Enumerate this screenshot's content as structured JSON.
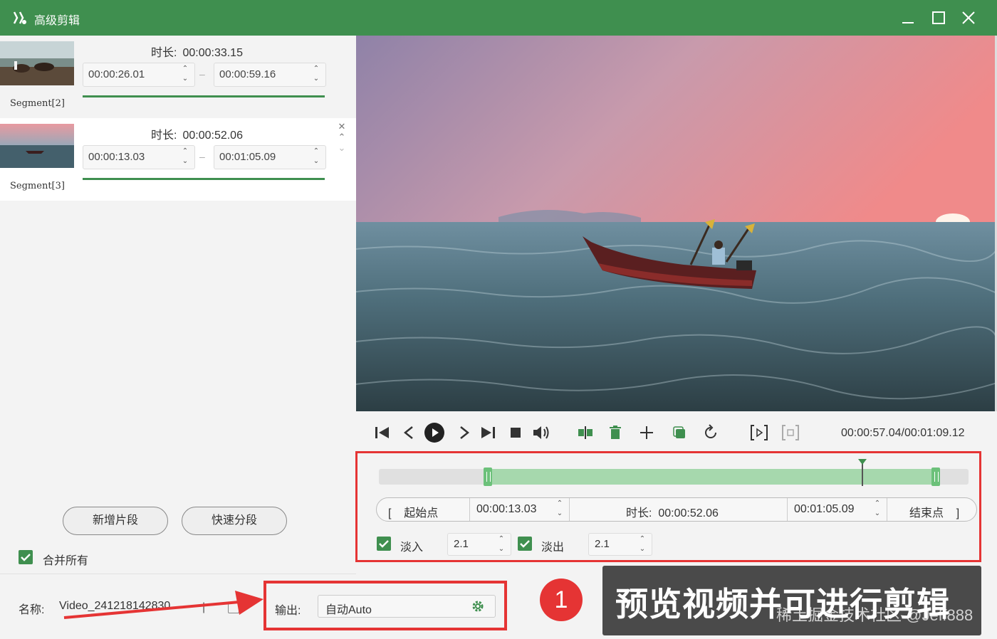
{
  "app": {
    "title": "高级剪辑"
  },
  "segments": [
    {
      "label": "Segment[2]",
      "duration_label": "时长:",
      "duration": "00:00:33.15",
      "start": "00:00:26.01",
      "end": "00:00:59.16"
    },
    {
      "label": "Segment[3]",
      "duration_label": "时长:",
      "duration": "00:00:52.06",
      "start": "00:00:13.03",
      "end": "00:01:05.09"
    }
  ],
  "left": {
    "add_segment": "新增片段",
    "quick_split": "快速分段",
    "merge_all": "合并所有",
    "merge_checked": true,
    "name_label": "名称:",
    "name_value": "Video_241218142830"
  },
  "player": {
    "time": "00:00:57.04/00:01:09.12"
  },
  "editor": {
    "track": {
      "selection_start": 0.185,
      "selection_end": 0.945,
      "playhead": 0.82
    },
    "start_point_label": "起始点",
    "start_time": "00:00:13.03",
    "duration_label": "时长:",
    "duration": "00:00:52.06",
    "end_time": "00:01:05.09",
    "end_point_label": "结束点",
    "fade_in_label": "淡入",
    "fade_in_value": "2.1",
    "fade_out_label": "淡出",
    "fade_out_value": "2.1"
  },
  "output": {
    "label": "输出:",
    "value": "自动Auto"
  },
  "annotation": {
    "badge": "1",
    "text": "预览视频并可进行剪辑",
    "watermark": "稀土掘金技术社区 @Jeff888"
  },
  "colors": {
    "brand": "#3f8f4f",
    "highlight": "#e53434",
    "selection": "#a6d8ad"
  }
}
